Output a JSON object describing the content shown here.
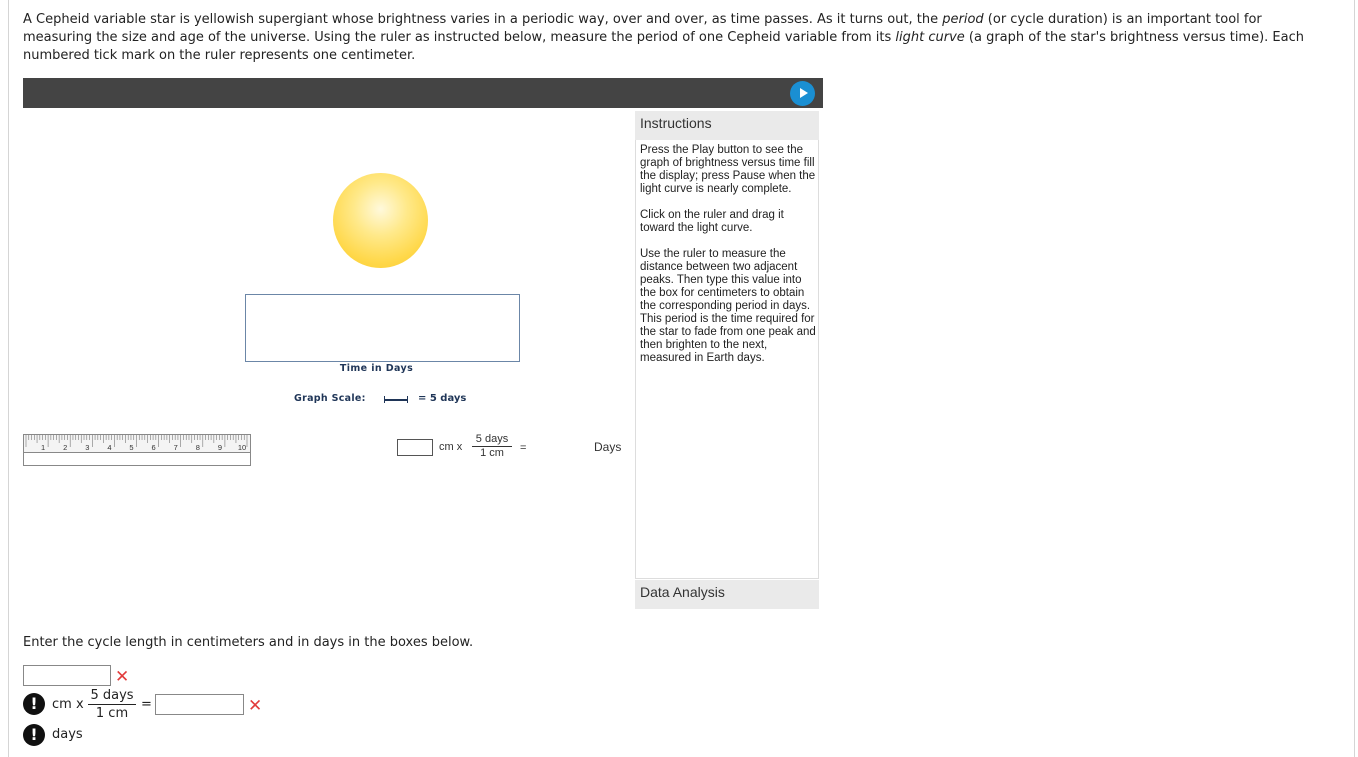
{
  "intro": {
    "part1": "A Cepheid variable star is yellowish supergiant whose brightness varies in a periodic way, over and over, as time passes. As it turns out, the ",
    "em1": "period",
    "part2": " (or cycle duration) is an important tool for measuring the size and age of the universe. Using the ruler as instructed below, measure the period of one Cepheid variable from its ",
    "em2": "light curve",
    "part3": " (a graph of the star's brightness versus time). Each numbered tick mark on the ruler represents one centimeter."
  },
  "simulation": {
    "time_axis_label": "Time in Days",
    "graph_scale_label": "Graph Scale:",
    "graph_scale_value": "= 5 days",
    "ruler_numbers": [
      "1",
      "2",
      "3",
      "4",
      "5",
      "6",
      "7",
      "8",
      "9",
      "10"
    ],
    "calc_cm_label": "cm x",
    "calc_frac_num": "5 days",
    "calc_frac_den": "1 cm",
    "calc_equals": "=",
    "calc_days_label": "Days",
    "play_icon": "play-icon"
  },
  "instructions": {
    "heading": "Instructions",
    "paragraphs": [
      "Press the Play button to see the graph of brightness versus time fill the display; press Pause when the light curve is nearly complete.",
      "Click on the ruler and drag it toward the light curve.",
      "Use the ruler to measure the distance between two adjacent peaks. Then type this value into the box for centimeters to obtain the corresponding period in days. This period is the time required for the star to fade from one peak and then brighten to the next, measured in Earth days."
    ]
  },
  "data_analysis": {
    "heading": "Data Analysis"
  },
  "answer": {
    "prompt": "Enter the cycle length in centimeters and in days in the boxes below.",
    "cm_value": "",
    "days_value": "",
    "cm_label": "cm x",
    "frac_num": "5 days",
    "frac_den": "1 cm",
    "equals": "=",
    "days_label": "days",
    "incorrect_mark": "✕",
    "warn_mark": "!"
  },
  "colors": {
    "accent_play": "#1a8fd3",
    "error_red": "#e23b3b",
    "graph_label_navy": "#1f3557",
    "star_yellow": "#ffd84a"
  }
}
